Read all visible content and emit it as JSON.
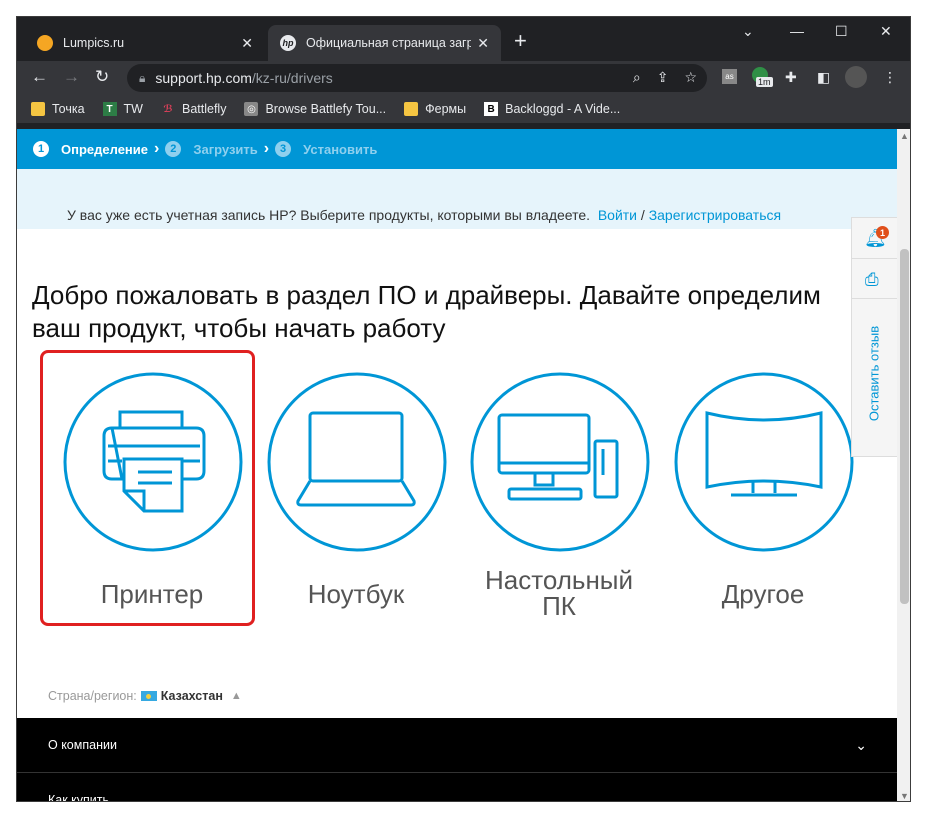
{
  "browser": {
    "tabs": [
      {
        "title": "Lumpics.ru",
        "icon": "lumpics-favicon",
        "active": false
      },
      {
        "title": "Официальная страница загрузк",
        "icon": "hp-favicon",
        "active": true
      }
    ],
    "new_tab_label": "+",
    "url_host": "support.hp.com",
    "url_path": "/kz-ru/drivers",
    "extension_badge": "1m",
    "bookmarks": [
      {
        "label": "Точка",
        "icon": "folder-icon"
      },
      {
        "label": "TW",
        "icon": "tw-icon"
      },
      {
        "label": "Battlefly",
        "icon": "battlefly-icon"
      },
      {
        "label": "Browse Battlefy Tou...",
        "icon": "battlefy-icon"
      },
      {
        "label": "Фермы",
        "icon": "folder-icon"
      },
      {
        "label": "Backloggd - A Vide...",
        "icon": "backloggd-icon"
      }
    ]
  },
  "page": {
    "steps": [
      {
        "num": "1",
        "label": "Определение",
        "active": true
      },
      {
        "num": "2",
        "label": "Загрузить",
        "active": false
      },
      {
        "num": "3",
        "label": "Установить",
        "active": false
      }
    ],
    "account_text": "У вас уже есть учетная запись HP? Выберите продукты, которыми вы владеете.",
    "login_link": "Войти",
    "separator": "/",
    "register_link": "Зарегистрироваться",
    "headline": "Добро пожаловать в раздел ПО и драйверы. Давайте определим ваш продукт, чтобы начать работу",
    "categories": [
      {
        "label": "Принтер",
        "icon": "printer-icon"
      },
      {
        "label": "Ноутбук",
        "icon": "laptop-icon"
      },
      {
        "label": "Настольный ПК",
        "icon": "desktop-icon"
      },
      {
        "label": "Другое",
        "icon": "monitor-icon"
      }
    ],
    "region_label": "Страна/регион:",
    "region_value": "Казахстан",
    "footer": [
      {
        "label": "О компании"
      },
      {
        "label": "Как купить"
      }
    ],
    "notification_count": "1",
    "feedback_label": "Оставить отзыв"
  },
  "colors": {
    "hp_blue": "#0096d6",
    "highlight_red": "#e02020",
    "chrome_dark": "#202124",
    "chrome_toolbar": "#35363a"
  }
}
